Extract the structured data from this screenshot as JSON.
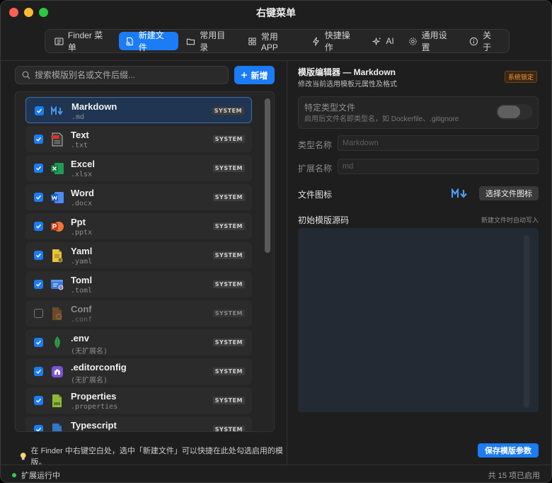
{
  "window": {
    "title": "右键菜单"
  },
  "tabs": [
    {
      "label": "Finder 菜单",
      "icon": "menu-icon"
    },
    {
      "label": "新建文件",
      "icon": "file-plus-icon",
      "active": true
    },
    {
      "label": "常用目录",
      "icon": "folder-icon"
    },
    {
      "label": "常用 APP",
      "icon": "grid-icon"
    },
    {
      "label": "快捷操作",
      "icon": "bolt-icon"
    },
    {
      "label": "AI",
      "icon": "sparkle-icon"
    },
    {
      "label": "通用设置",
      "icon": "gear-icon"
    },
    {
      "label": "关于",
      "icon": "info-icon"
    }
  ],
  "left": {
    "search_placeholder": "搜索模版别名或文件后缀...",
    "add_label": "新增",
    "items": [
      {
        "name": "Markdown",
        "ext": ".md",
        "badge": "SYSTEM",
        "checked": true,
        "icon": "markdown-icon"
      },
      {
        "name": "Text",
        "ext": ".txt",
        "badge": "SYSTEM",
        "checked": true,
        "icon": "txt-file-icon"
      },
      {
        "name": "Excel",
        "ext": ".xlsx",
        "badge": "SYSTEM",
        "checked": true,
        "icon": "excel-icon"
      },
      {
        "name": "Word",
        "ext": ".docx",
        "badge": "SYSTEM",
        "checked": true,
        "icon": "word-icon"
      },
      {
        "name": "Ppt",
        "ext": ".pptx",
        "badge": "SYSTEM",
        "checked": true,
        "icon": "powerpoint-icon"
      },
      {
        "name": "Yaml",
        "ext": ".yaml",
        "badge": "SYSTEM",
        "checked": true,
        "icon": "yaml-file-icon"
      },
      {
        "name": "Toml",
        "ext": ".toml",
        "badge": "SYSTEM",
        "checked": true,
        "icon": "toml-file-icon"
      },
      {
        "name": "Conf",
        "ext": ".conf",
        "badge": "SYSTEM",
        "checked": false,
        "icon": "conf-file-icon"
      },
      {
        "name": ".env",
        "ext": "(无扩展名)",
        "badge": "SYSTEM",
        "checked": true,
        "icon": "env-leaf-icon"
      },
      {
        "name": ".editorconfig",
        "ext": "(无扩展名)",
        "badge": "SYSTEM",
        "checked": true,
        "icon": "editorconfig-icon"
      },
      {
        "name": "Properties",
        "ext": ".properties",
        "badge": "SYSTEM",
        "checked": true,
        "icon": "properties-file-icon"
      },
      {
        "name": "Typescript",
        "ext": "",
        "badge": "SYSTEM",
        "checked": true,
        "icon": "typescript-icon"
      }
    ],
    "tip": "在 Finder 中右键空白处，选中「新建文件」可以快捷在此处勾选启用的模版。"
  },
  "editor": {
    "title": "模版编辑器 — Markdown",
    "subtitle": "修改当前选用模板元属性及格式",
    "lock_badge": "系统锁定",
    "special_title": "特定类型文件",
    "special_desc": "启用后文件名即类型名，如 Dockerfile、.gitignore",
    "type_label": "类型名称",
    "type_value": "Markdown",
    "ext_label": "扩展名称",
    "ext_value": "md",
    "icon_label": "文件图标",
    "pick_icon_label": "选择文件图标",
    "source_label": "初始模版源码",
    "source_hint": "新建文件时自动写入",
    "save_label": "保存模版参数"
  },
  "status": {
    "left": "扩展运行中",
    "right": "共 15 项已启用"
  },
  "colors": {
    "accent": "#1b7cf5",
    "running": "#2ecc52",
    "lock": "#f39a3a"
  }
}
